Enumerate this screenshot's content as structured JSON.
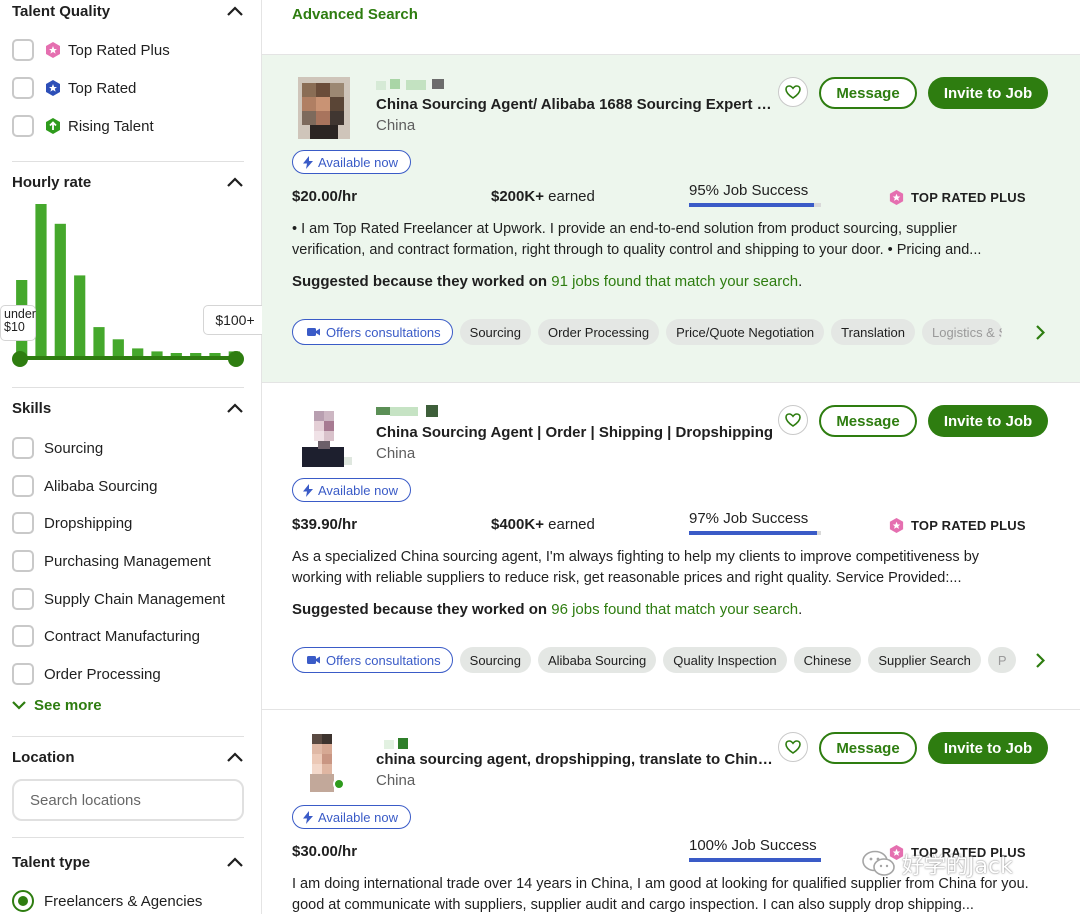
{
  "colors": {
    "brand_green": "#2e7d10",
    "link_blue": "#3a5bc7",
    "pink": "#e56fb0",
    "highlight_bg": "#edf6ed"
  },
  "sidebar": {
    "talent_quality": {
      "title": "Talent Quality",
      "items": [
        {
          "label": "Top Rated Plus",
          "icon": "top-rated-plus-badge-icon",
          "checked": false
        },
        {
          "label": "Top Rated",
          "icon": "top-rated-badge-icon",
          "checked": false
        },
        {
          "label": "Rising Talent",
          "icon": "rising-talent-badge-icon",
          "checked": false
        }
      ]
    },
    "hourly_rate": {
      "title": "Hourly rate",
      "min_label": "under\n$10",
      "max_label": "$100+",
      "histogram": [
        0.5,
        1.0,
        0.87,
        0.53,
        0.19,
        0.11,
        0.05,
        0.03,
        0.02,
        0.02,
        0.02,
        0.03
      ]
    },
    "skills": {
      "title": "Skills",
      "items": [
        {
          "label": "Sourcing"
        },
        {
          "label": "Alibaba Sourcing"
        },
        {
          "label": "Dropshipping"
        },
        {
          "label": "Purchasing Management"
        },
        {
          "label": "Supply Chain Management"
        },
        {
          "label": "Contract Manufacturing"
        },
        {
          "label": "Order Processing"
        }
      ],
      "see_more": "See more"
    },
    "location": {
      "title": "Location",
      "placeholder": "Search locations"
    },
    "talent_type": {
      "title": "Talent type",
      "selected": "Freelancers & Agencies"
    }
  },
  "main": {
    "advanced_search": "Advanced Search",
    "buttons": {
      "message": "Message",
      "invite": "Invite to Job"
    },
    "available_now": "Available now",
    "offers_consultations": "Offers consultations",
    "top_rated_plus": "TOP RATED PLUS",
    "suggest_prefix": "Suggested because they worked on",
    "cards": [
      {
        "title": "China Sourcing Agent/ Alibaba 1688 Sourcing Expert 15 ...",
        "country": "China",
        "rate": "$20.00/hr",
        "earned_amount": "$200K+",
        "earned_label": "earned",
        "job_success": "95% Job Success",
        "job_success_pct": 95,
        "description": "• I am Top Rated Freelancer at Upwork. I provide an end-to-end solution from product sourcing, supplier verification, and contract formation, right through to quality control and shipping to your door. • Pricing and...",
        "suggest_link": "91 jobs found that match your search",
        "tags": [
          "Sourcing",
          "Order Processing",
          "Price/Quote Negotiation",
          "Translation",
          "Logistics & S"
        ]
      },
      {
        "title": "China Sourcing Agent | Order | Shipping | Dropshipping",
        "country": "China",
        "rate": "$39.90/hr",
        "earned_amount": "$400K+",
        "earned_label": "earned",
        "job_success": "97% Job Success",
        "job_success_pct": 97,
        "description": "As a specialized China sourcing agent, I'm always fighting to help my clients to improve competitiveness by working with reliable suppliers to reduce risk, get reasonable prices and right quality. Service Provided:...",
        "suggest_link": "96 jobs found that match your search",
        "tags": [
          "Sourcing",
          "Alibaba Sourcing",
          "Quality Inspection",
          "Chinese",
          "Supplier Search",
          "P"
        ]
      },
      {
        "title": "china sourcing agent, dropshipping, translate to Chinese,...",
        "country": "China",
        "rate": "$30.00/hr",
        "job_success": "100% Job Success",
        "job_success_pct": 100,
        "description": "I am doing international trade over 14 years in China, I am good at looking for qualified supplier from China for you. good at communicate with suppliers, supplier audit and cargo inspection. I can also supply drop shipping..."
      }
    ]
  },
  "watermark": "好学的Jack"
}
